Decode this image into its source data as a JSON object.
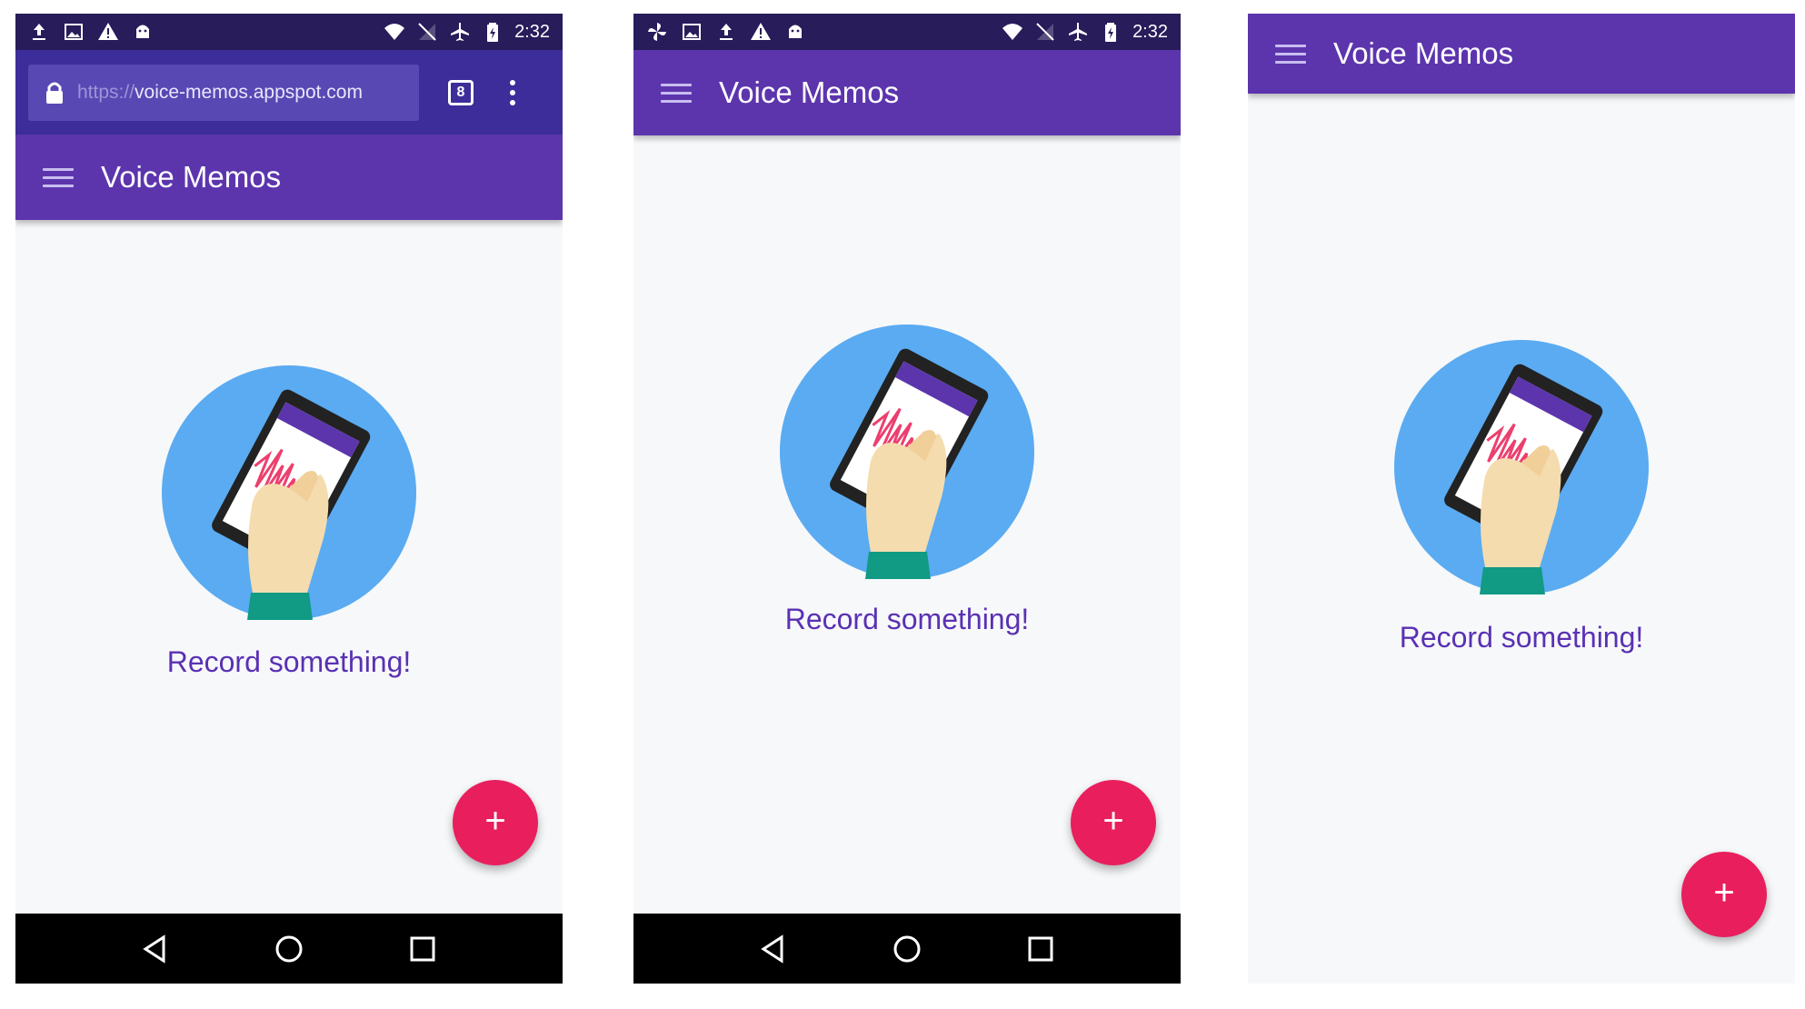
{
  "app": {
    "title": "Voice Memos",
    "empty_prompt": "Record something!",
    "fab_label": "+"
  },
  "statusbar": {
    "time": "2:32"
  },
  "browser": {
    "url_scheme": "https://",
    "url_host": "voice-memos.appspot.com",
    "tab_count": "8"
  },
  "colors": {
    "statusbar": "#281c5b",
    "browser_toolbar": "#3c2d9a",
    "appbar": "#5c35ad",
    "fab": "#e91e5d",
    "prompt_text": "#5a31b3",
    "hero_circle": "#5aabf1"
  },
  "icons": {
    "status_left_browser": [
      "upload-icon",
      "image-icon",
      "warning-icon",
      "android-icon"
    ],
    "status_left_app": [
      "pinwheel-icon",
      "image-icon",
      "upload-icon",
      "warning-icon",
      "android-icon"
    ],
    "status_right": [
      "wifi-icon",
      "no-signal-icon",
      "airplane-icon",
      "battery-charging-icon"
    ],
    "navbar": [
      "back-icon",
      "home-icon",
      "recents-icon"
    ],
    "hero": "hand-holding-phone-illustration"
  }
}
